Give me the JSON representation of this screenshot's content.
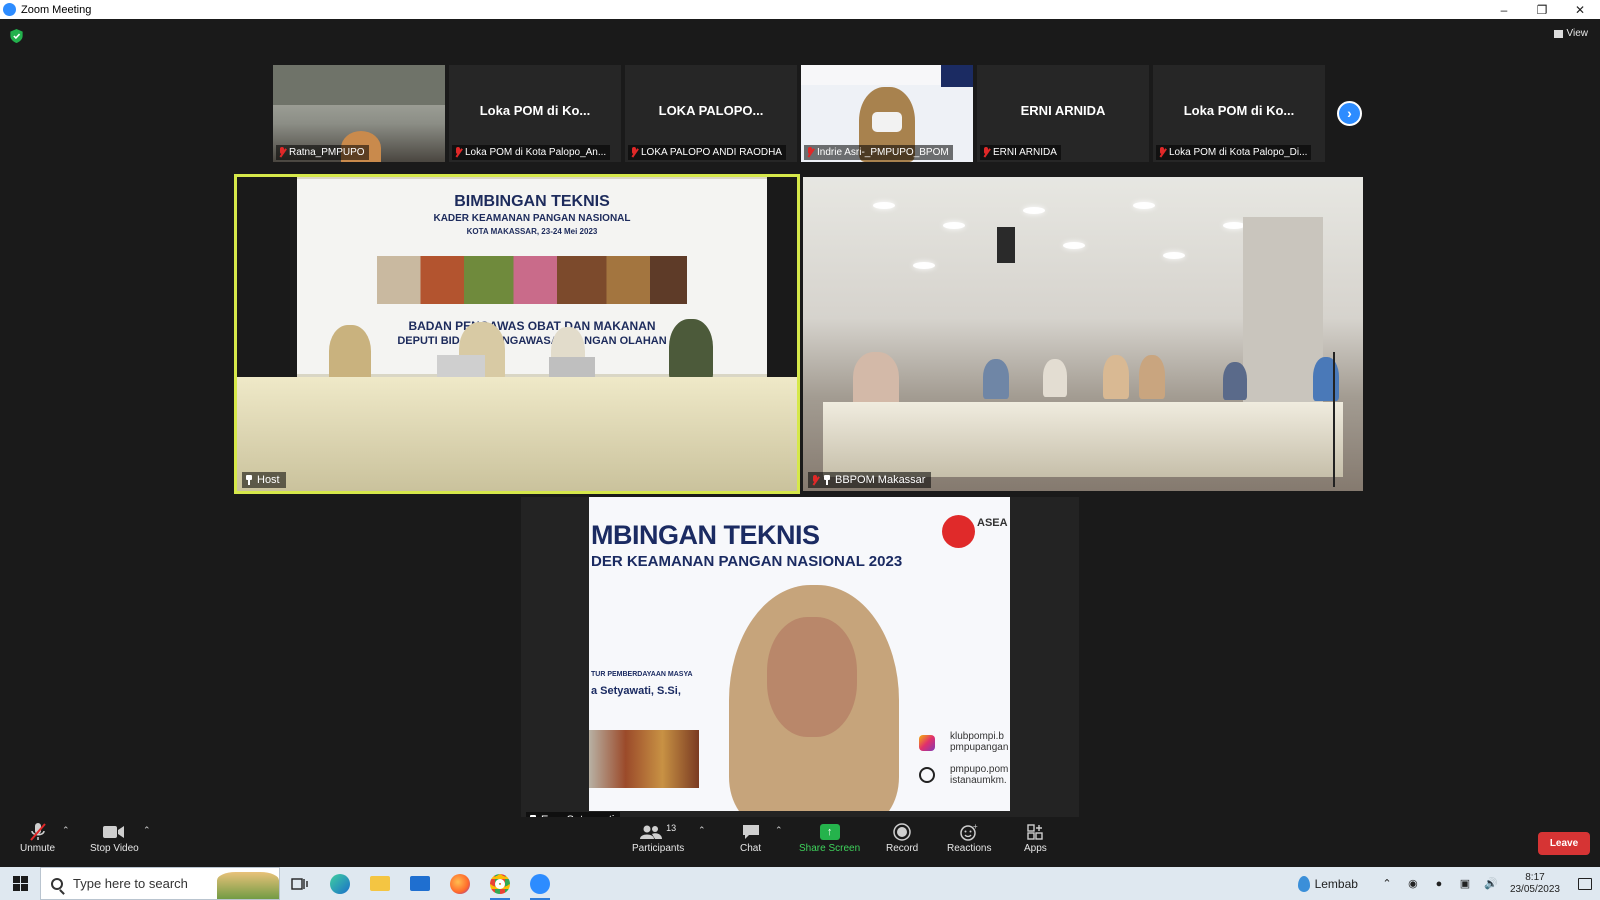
{
  "window": {
    "title": "Zoom Meeting"
  },
  "top": {
    "view_label": "View"
  },
  "thumbnails": [
    {
      "label": "Ratna_PMPUPO",
      "big_name": ""
    },
    {
      "label": "Loka POM di Kota Palopo_An...",
      "big_name": "Loka POM di Ko..."
    },
    {
      "label": "LOKA PALOPO ANDI RAODHA",
      "big_name": "LOKA PALOPO..."
    },
    {
      "label": "Indrie Asri-_PMPUPO_BPOM",
      "big_name": ""
    },
    {
      "label": "ERNI ARNIDA",
      "big_name": "ERNI ARNIDA"
    },
    {
      "label": "Loka POM di Kota Palopo_Di...",
      "big_name": "Loka POM di Ko..."
    }
  ],
  "tiles": {
    "host": {
      "label": "Host",
      "banner_title": "BIMBINGAN TEKNIS",
      "banner_sub": "KADER KEAMANAN PANGAN NASIONAL",
      "banner_city": "KOTA MAKASSAR, 23-24 Mei 2023",
      "banner_org1": "BADAN PENGAWAS OBAT DAN MAKANAN",
      "banner_org2": "DEPUTI BIDANG PENGAWASAN PANGAN OLAHAN"
    },
    "bbpom": {
      "label": "BBPOM Makassar"
    },
    "speaker": {
      "label": "Ema Setyawati",
      "slide_title": "MBINGAN TEKNIS",
      "slide_sub": "DER KEAMANAN PANGAN NASIONAL 2023",
      "slide_small": "TUR PEMBERDAYAAN MASYA",
      "slide_name": "a Setyawati, S.Si,",
      "slide_ig": "klubpompi.b\npmpupangan",
      "slide_web": "pmpupo.pom\nistanaumkm.",
      "slide_asean": "ASEA"
    }
  },
  "toolbar": {
    "unmute": "Unmute",
    "stop_video": "Stop Video",
    "participants": "Participants",
    "participants_count": "13",
    "chat": "Chat",
    "share_screen": "Share Screen",
    "record": "Record",
    "reactions": "Reactions",
    "apps": "Apps",
    "leave": "Leave"
  },
  "taskbar": {
    "search_placeholder": "Type here to search",
    "weather": "Lembab",
    "time": "8:17",
    "date": "23/05/2023"
  },
  "colors": {
    "accent": "#2d8cff",
    "active_speaker_border": "#d6e84a",
    "share_green": "#25b34c",
    "leave_red": "#d63434",
    "muted_red": "#e02828"
  }
}
